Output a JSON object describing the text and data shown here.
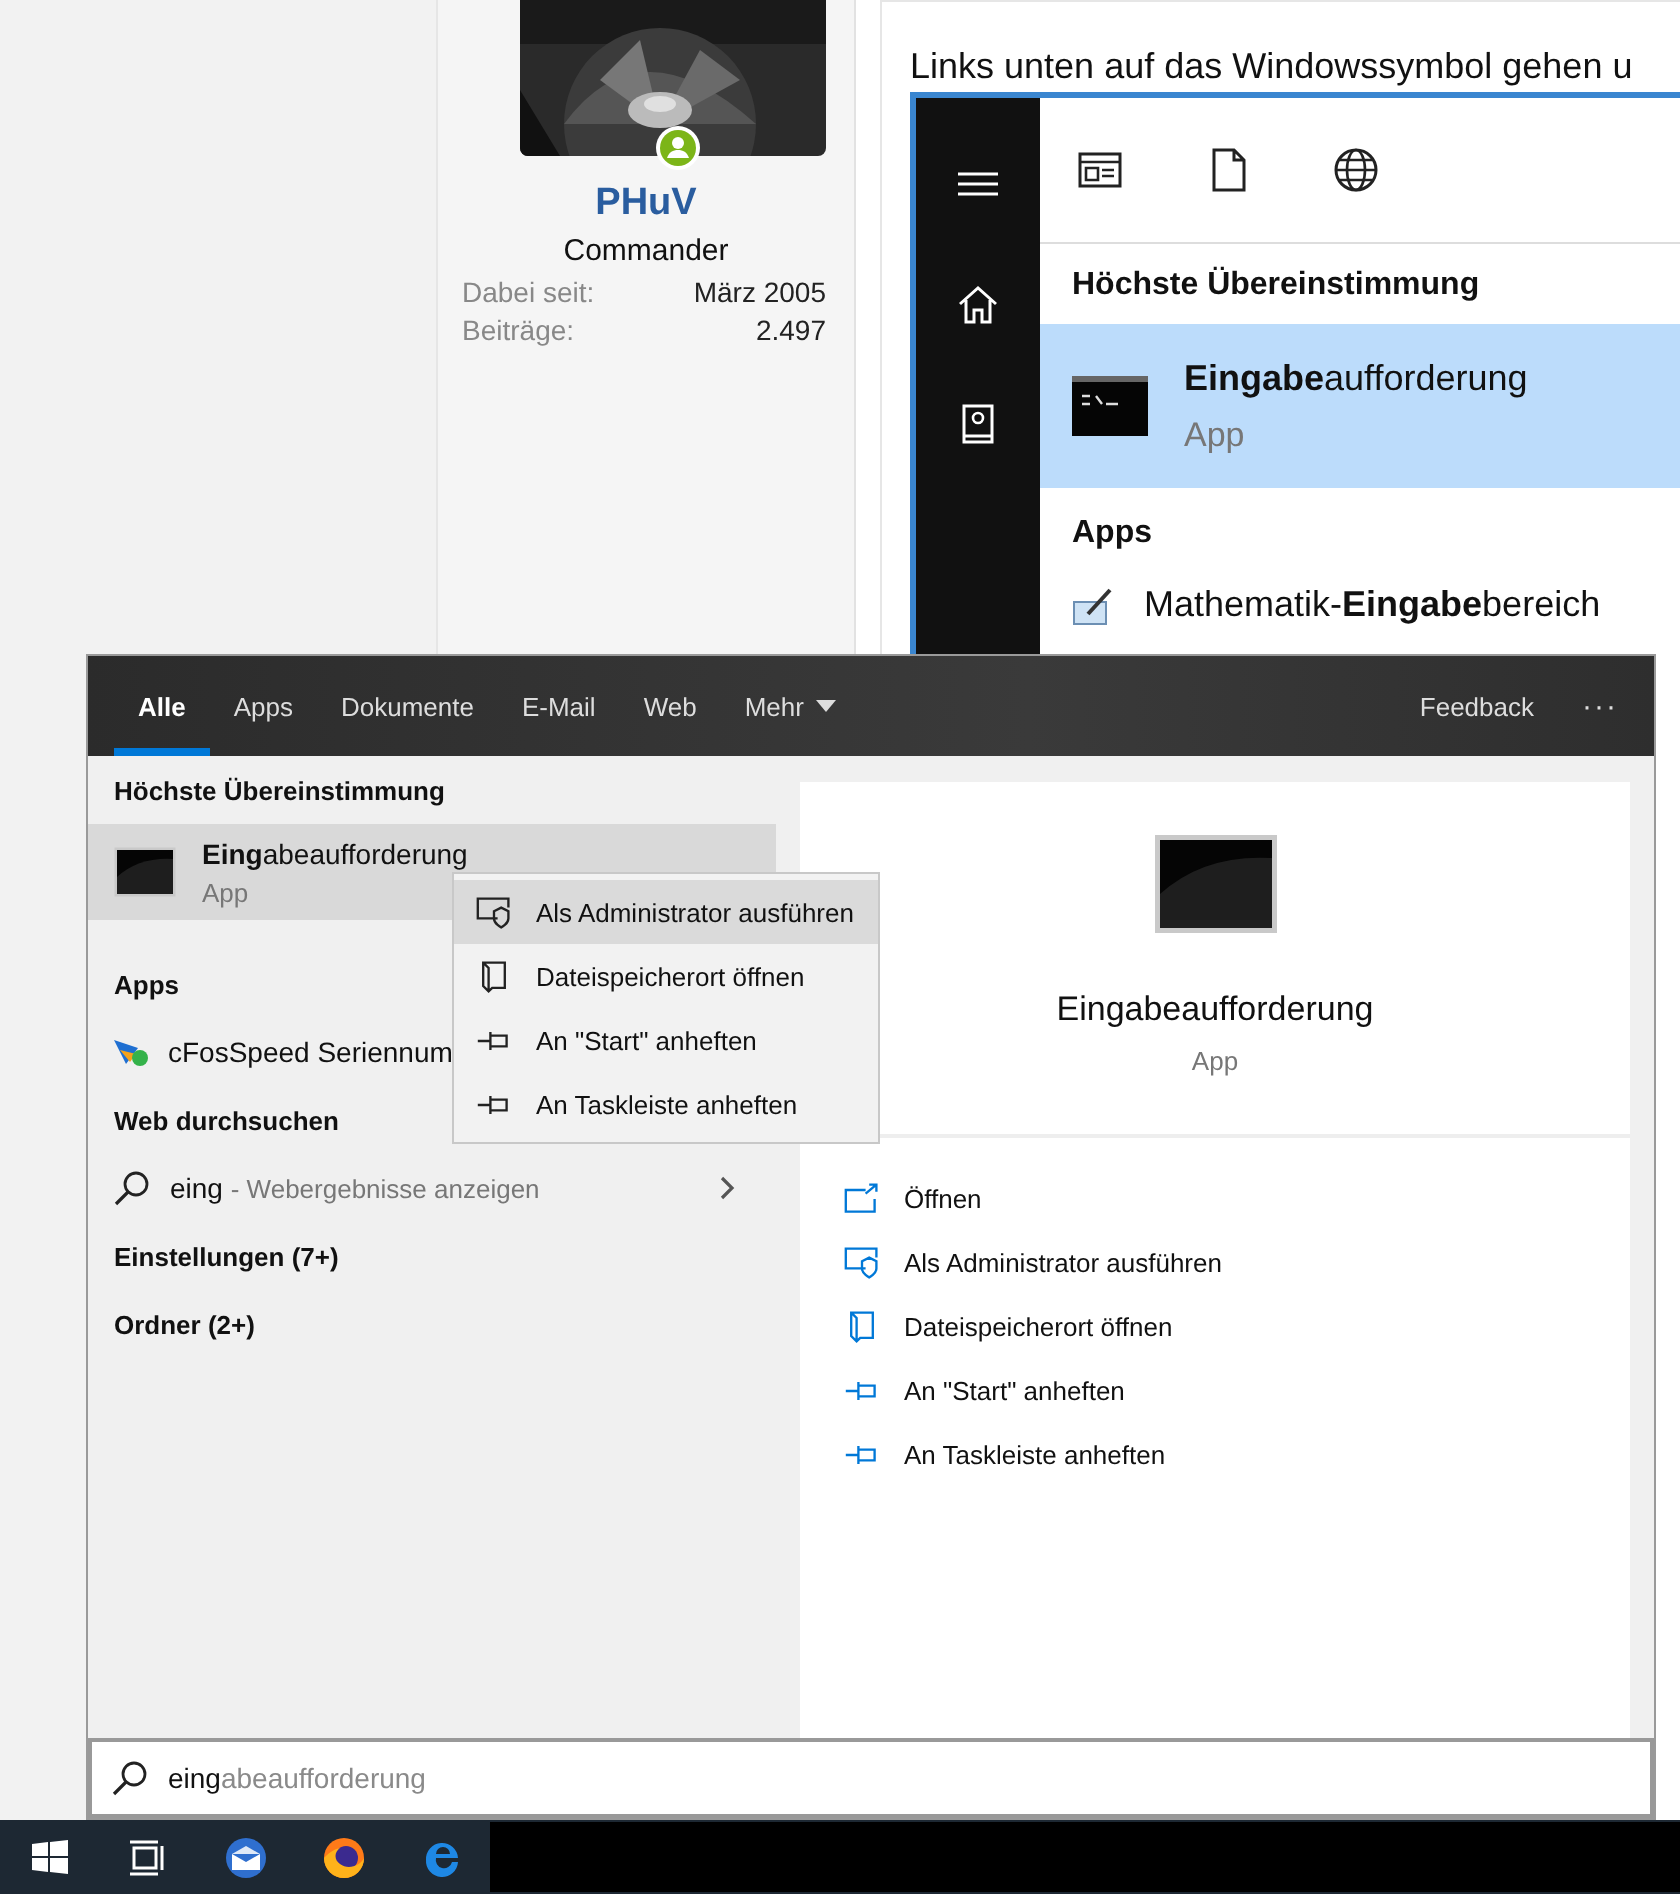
{
  "forum": {
    "user": {
      "name": "PHuV",
      "rank": "Commander",
      "stats": [
        {
          "label": "Dabei seit:",
          "value": "März 2005"
        },
        {
          "label": "Beiträge:",
          "value": "2.497"
        }
      ]
    },
    "post": {
      "text": "Links unten auf das Windowssymbol gehen u",
      "screenshot": {
        "heading": "Höchste Übereinstimmung",
        "best_match": {
          "title": "**Eingabe**aufforderung",
          "subtitle": "App",
          "selected": true
        },
        "apps_heading": "Apps",
        "app": "Mathematik-**Eingabe**bereich"
      }
    }
  },
  "search": {
    "tabs": [
      {
        "label": "Alle",
        "selected": true,
        "kind": "plain"
      },
      {
        "label": "Apps",
        "selected": false,
        "kind": "plain"
      },
      {
        "label": "Dokumente",
        "selected": false,
        "kind": "plain"
      },
      {
        "label": "E-Mail",
        "selected": false,
        "kind": "plain"
      },
      {
        "label": "Web",
        "selected": false,
        "kind": "plain"
      },
      {
        "label": "Mehr",
        "selected": false,
        "kind": "menu"
      }
    ],
    "feedback": "Feedback",
    "more": "···",
    "best_heading": "Höchste Übereinstimmung",
    "best": {
      "title": "**Eing**abeaufforderung",
      "subtitle": "App",
      "selected": true
    },
    "apps_heading": "Apps",
    "apps": [
      {
        "label": "cFosSpeed Seriennum"
      }
    ],
    "web_heading": "Web durchsuchen",
    "web": {
      "query": "eing",
      "hint": "- Webergebnisse anzeigen"
    },
    "sections": [
      "Einstellungen (7+)",
      "Ordner (2+)"
    ],
    "context_menu": [
      {
        "label": "Als Administrator ausführen",
        "kind": "shield",
        "selected": true
      },
      {
        "label": "Dateispeicherort öffnen",
        "kind": "folder",
        "selected": false
      },
      {
        "label": "An \"Start\" anheften",
        "kind": "pin",
        "selected": false
      },
      {
        "label": "An Taskleiste anheften",
        "kind": "pin",
        "selected": false
      }
    ],
    "preview": {
      "title": "Eingabeaufforderung",
      "subtitle": "App",
      "actions": [
        {
          "label": "Öffnen",
          "kind": "open"
        },
        {
          "label": "Als Administrator ausführen",
          "kind": "shield"
        },
        {
          "label": "Dateispeicherort öffnen",
          "kind": "folder"
        },
        {
          "label": "An \"Start\" anheften",
          "kind": "pin"
        },
        {
          "label": "An Taskleiste anheften",
          "kind": "pin"
        }
      ]
    },
    "field": {
      "value": "eing",
      "completion": "abeaufforderung"
    }
  }
}
